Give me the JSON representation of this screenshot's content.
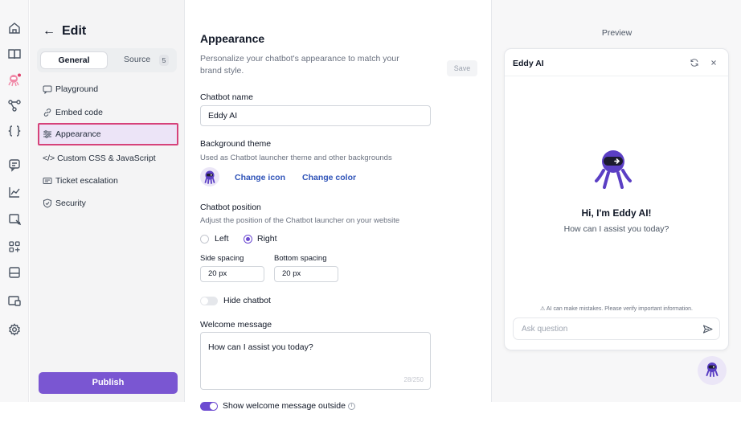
{
  "colors": {
    "accent": "#7a56d2",
    "link": "#2f53b8",
    "highlight_border": "#d6427a",
    "bot_purple": "#6b45d6"
  },
  "rail": {
    "icons": [
      "home-icon",
      "book-icon",
      "bot-icon",
      "workflow-icon",
      "code-braces-icon",
      "chat-icon",
      "analytics-icon",
      "inbox-icon",
      "apps-icon",
      "layout-icon",
      "window-icon",
      "settings-icon"
    ]
  },
  "sidebar": {
    "back_glyph": "←",
    "title": "Edit",
    "tabs": {
      "general": "General",
      "source": "Source",
      "source_count": "5"
    },
    "items": [
      {
        "label": "Playground",
        "icon": "chat-bubble-icon"
      },
      {
        "label": "Embed code",
        "icon": "link-icon"
      },
      {
        "label": "Appearance",
        "icon": "sliders-icon",
        "active": true
      },
      {
        "label": "</> Custom CSS & JavaScript",
        "icon": ""
      },
      {
        "label": "Ticket escalation",
        "icon": "ticket-icon"
      },
      {
        "label": "Security",
        "icon": "shield-icon"
      }
    ],
    "publish": "Publish"
  },
  "main": {
    "title": "Appearance",
    "subtitle": "Personalize your chatbot's appearance to match your brand style.",
    "save": "Save",
    "chatbot_name_label": "Chatbot name",
    "chatbot_name_value": "Eddy AI",
    "bg_theme_label": "Background theme",
    "bg_theme_hint": "Used as Chatbot launcher theme and other backgrounds",
    "change_icon": "Change icon",
    "change_color": "Change color",
    "position_label": "Chatbot position",
    "position_hint": "Adjust the position of the Chatbot launcher on your website",
    "position_left": "Left",
    "position_right": "Right",
    "position_selected": "Right",
    "side_spacing_label": "Side spacing",
    "side_spacing_value": "20 px",
    "bottom_spacing_label": "Bottom spacing",
    "bottom_spacing_value": "20 px",
    "hide_chatbot_label": "Hide chatbot",
    "hide_chatbot_on": false,
    "welcome_label": "Welcome message",
    "welcome_value": "How can I assist you today?",
    "welcome_counter": "28/250",
    "show_outside_label": "Show welcome message outside",
    "show_outside_on": true,
    "info_glyph": "i"
  },
  "preview": {
    "title": "Preview",
    "card_name": "Eddy AI",
    "refresh_glyph": "↻",
    "close_glyph": "×",
    "greeting": "Hi, I'm Eddy AI!",
    "greeting_sub": "How can I assist you today?",
    "disclaimer": "⚠ AI can make mistakes. Please verify important information.",
    "ask_placeholder": "Ask question"
  }
}
